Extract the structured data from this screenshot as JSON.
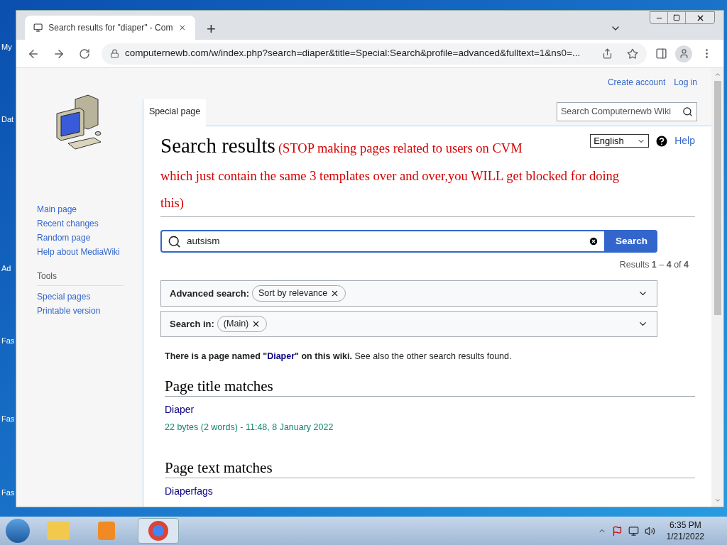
{
  "desktop": {
    "icon_labels": [
      "My",
      "Dat",
      "Ad",
      "Fas",
      "Fas",
      "Fas"
    ]
  },
  "browser": {
    "tab_title": "Search results for \"diaper\" - Com",
    "new_tab": "+",
    "url": "computernewb.com/w/index.php?search=diaper&title=Special:Search&profile=advanced&fulltext=1&ns0=..."
  },
  "wiki": {
    "personal_links": [
      "Create account",
      "Log in"
    ],
    "navigation": [
      "Main page",
      "Recent changes",
      "Random page",
      "Help about MediaWiki"
    ],
    "tools": {
      "heading": "Tools",
      "items": [
        "Special pages",
        "Printable version"
      ]
    },
    "page_tab": {
      "label": "Special page",
      "selected": true
    },
    "search_placeholder": "Search Computernewb Wiki",
    "language": "English",
    "help": "Help",
    "heading": "Search results",
    "notice_lines": [
      "(STOP making pages related to users on CVM",
      "which just contain the same 3 templates over and over,you WILL get blocked for doing",
      "this)"
    ],
    "query": "autsism",
    "search_button": "Search",
    "results_summary": "Results **1** – **4** of **4**",
    "filters": [
      {
        "label": "Advanced search:",
        "chip": "Sort by relevance"
      },
      {
        "label": "Search in:",
        "chip": "(Main)"
      }
    ],
    "exact_match": {
      "bold": "There is a page named \"",
      "link": "Diaper",
      "bold_end": "\" on this wiki.",
      "rest": " See also the other search results found."
    },
    "sections": [
      {
        "title": "Page title matches",
        "results": [
          {
            "title": "Diaper",
            "meta": "22 bytes (2 words) - 11:48, 8 January 2022"
          }
        ]
      },
      {
        "title": "Page text matches",
        "results": [
          {
            "title": "Diaperfags"
          }
        ]
      }
    ]
  },
  "taskbar": {
    "time": "6:35 PM",
    "date": "1/21/2022"
  }
}
